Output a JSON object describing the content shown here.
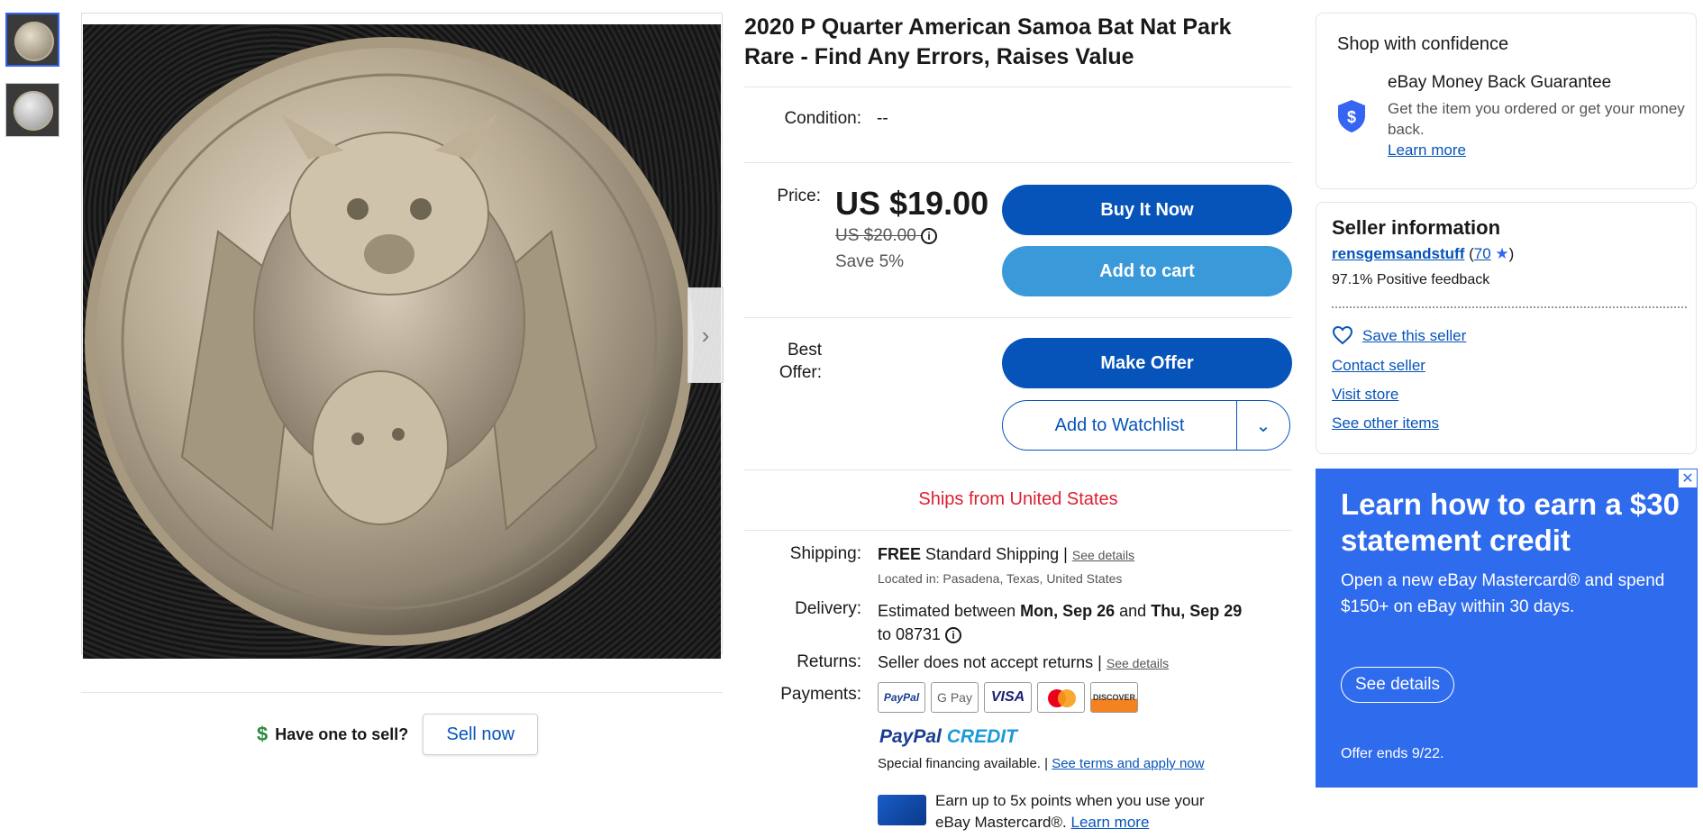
{
  "title": "2020 P Quarter American Samoa Bat Nat Park Rare - Find Any Errors, Raises Value",
  "condition": {
    "label": "Condition:",
    "value": "--"
  },
  "price": {
    "label": "Price:",
    "current": "US $19.00",
    "original": "US $20.00",
    "save": "Save 5%"
  },
  "actions": {
    "buy_now": "Buy It Now",
    "add_to_cart": "Add to cart",
    "best_offer_label": "Best Offer:",
    "make_offer": "Make Offer",
    "add_to_watchlist": "Add to Watchlist"
  },
  "ships_from": "Ships from United States",
  "shipping": {
    "label": "Shipping:",
    "free": "FREE",
    "method": "Standard Shipping",
    "sep": "|",
    "details_link": "See details",
    "located": "Located in: Pasadena, Texas, United States"
  },
  "delivery": {
    "label": "Delivery:",
    "est": "Estimated between",
    "d1": "Mon, Sep 26",
    "and": "and",
    "d2": "Thu, Sep 29",
    "to": "to 08731"
  },
  "returns": {
    "label": "Returns:",
    "value": "Seller does not accept returns",
    "sep": "|",
    "link": "See details"
  },
  "payments": {
    "label": "Payments:",
    "methods": [
      "PayPal",
      "G Pay",
      "VISA",
      "",
      "DISCOVER"
    ],
    "paypal_credit_a": "PayPal",
    "paypal_credit_b": "CREDIT",
    "financing": "Special financing available.",
    "sep": "|",
    "terms_link": "See terms and apply now",
    "earn_line1": "Earn up to 5x points when you use your",
    "earn_line2": "eBay Mastercard®.",
    "learn_more": "Learn more"
  },
  "sell": {
    "question": "Have one to sell?",
    "button": "Sell now"
  },
  "confidence": {
    "title": "Shop with confidence",
    "guarantee_title": "eBay Money Back Guarantee",
    "guarantee_text": "Get the item you ordered or get your money back.",
    "learn_more": "Learn more"
  },
  "seller": {
    "title": "Seller information",
    "name": "rensgemsandstuff",
    "open": " (",
    "score": "70",
    "close": ")",
    "feedback": "97.1% Positive feedback",
    "save": "Save this seller",
    "contact": "Contact seller",
    "visit": "Visit store",
    "other": "See other items"
  },
  "ad": {
    "title": "Learn how to earn a $30 statement credit",
    "text": "Open a new eBay Mastercard® and spend $150+ on eBay within 30 days.",
    "button": "See details",
    "small": "Offer ends 9/22.",
    "close": "✕"
  },
  "colors": {
    "primary": "#0654ba",
    "secondary": "#3a9ad9",
    "ships": "#dd1e31",
    "ad_bg": "#2f6bed"
  },
  "icons": [
    "dollar-icon",
    "info-icon",
    "chevron-down-icon",
    "shield-dollar-icon",
    "star-icon",
    "heart-icon",
    "chevron-right-icon",
    "close-icon"
  ]
}
